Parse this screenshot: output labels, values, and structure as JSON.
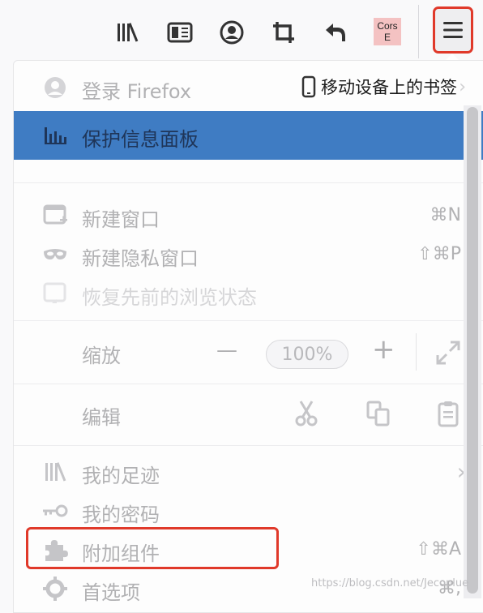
{
  "toolbar": {
    "cors_line1": "Cors",
    "cors_line2": "E"
  },
  "header": {
    "mobile_bookmarks": "移动设备上的书签"
  },
  "menu": {
    "sign_in": "登录 Firefox",
    "protections": "保护信息面板",
    "new_window": {
      "label": "新建窗口",
      "shortcut": "⌘N"
    },
    "new_private_window": {
      "label": "新建隐私窗口",
      "shortcut": "⇧⌘P"
    },
    "restore_session": "恢复先前的浏览状态",
    "zoom": {
      "label": "缩放",
      "minus": "—",
      "value": "100%",
      "plus": "+"
    },
    "edit": {
      "label": "编辑"
    },
    "library": "我的足迹",
    "passwords": "我的密码",
    "addons": {
      "label": "附加组件",
      "shortcut": "⇧⌘A"
    },
    "preferences": {
      "label": "首选项",
      "shortcut": "⌘,"
    }
  },
  "watermark": "https://blog.csdn.net/Jecoplue"
}
